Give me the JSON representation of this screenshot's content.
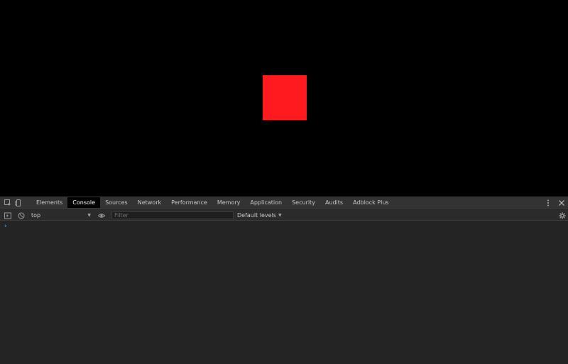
{
  "page": {
    "square_color": "#ff1a1f"
  },
  "devtools": {
    "tabs": [
      {
        "label": "Elements"
      },
      {
        "label": "Console"
      },
      {
        "label": "Sources"
      },
      {
        "label": "Network"
      },
      {
        "label": "Performance"
      },
      {
        "label": "Memory"
      },
      {
        "label": "Application"
      },
      {
        "label": "Security"
      },
      {
        "label": "Audits"
      },
      {
        "label": "Adblock Plus"
      }
    ],
    "active_tab": "Console",
    "icons": {
      "inspect": "inspect-element-icon",
      "device": "device-toolbar-icon",
      "more": "more-vertical-icon",
      "close": "close-icon",
      "sidebar": "show-sidebar-icon",
      "clear": "clear-console-icon",
      "eye": "live-expression-eye-icon",
      "settings": "gear-icon"
    },
    "toolbar": {
      "context": "top",
      "filter_placeholder": "Filter",
      "levels": "Default levels"
    },
    "console": {
      "prompt": "›"
    }
  }
}
